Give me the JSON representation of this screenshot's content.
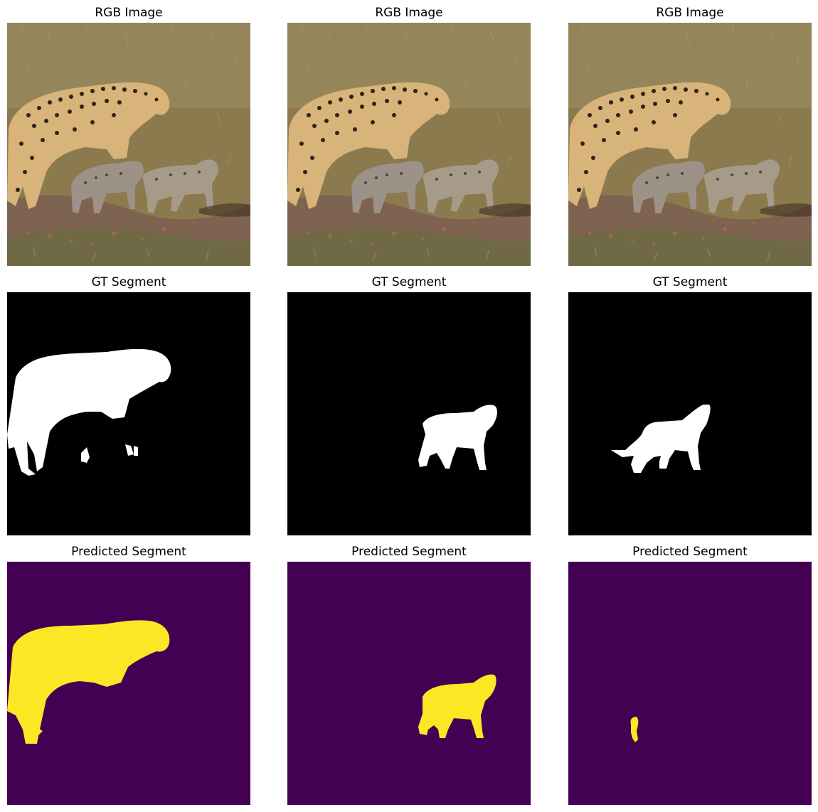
{
  "row_titles": {
    "rgb": "RGB Image",
    "gt": "GT Segment",
    "pred": "Predicted Segment"
  },
  "colors": {
    "background": "#ffffff",
    "gt_background": "#000000",
    "gt_mask": "#ffffff",
    "pred_background": "#440154",
    "pred_mask": "#fde725",
    "grass": "#8a7a4e",
    "dirt": "#7e6350",
    "cheetah_fur": "#d8b47a",
    "cub_fur": "#9c9288"
  },
  "panels": [
    {
      "row": "rgb",
      "title": "RGB Image",
      "kind": "photo"
    },
    {
      "row": "rgb",
      "title": "RGB Image",
      "kind": "photo"
    },
    {
      "row": "rgb",
      "title": "RGB Image",
      "kind": "photo"
    },
    {
      "row": "gt",
      "title": "GT Segment",
      "kind": "mask",
      "instance": "adult-cheetah"
    },
    {
      "row": "gt",
      "title": "GT Segment",
      "kind": "mask",
      "instance": "cub-right"
    },
    {
      "row": "gt",
      "title": "GT Segment",
      "kind": "mask",
      "instance": "cub-left"
    },
    {
      "row": "pred",
      "title": "Predicted Segment",
      "kind": "mask",
      "instance": "adult-cheetah"
    },
    {
      "row": "pred",
      "title": "Predicted Segment",
      "kind": "mask",
      "instance": "cub-right"
    },
    {
      "row": "pred",
      "title": "Predicted Segment",
      "kind": "mask",
      "instance": "cub-left-partial"
    }
  ]
}
